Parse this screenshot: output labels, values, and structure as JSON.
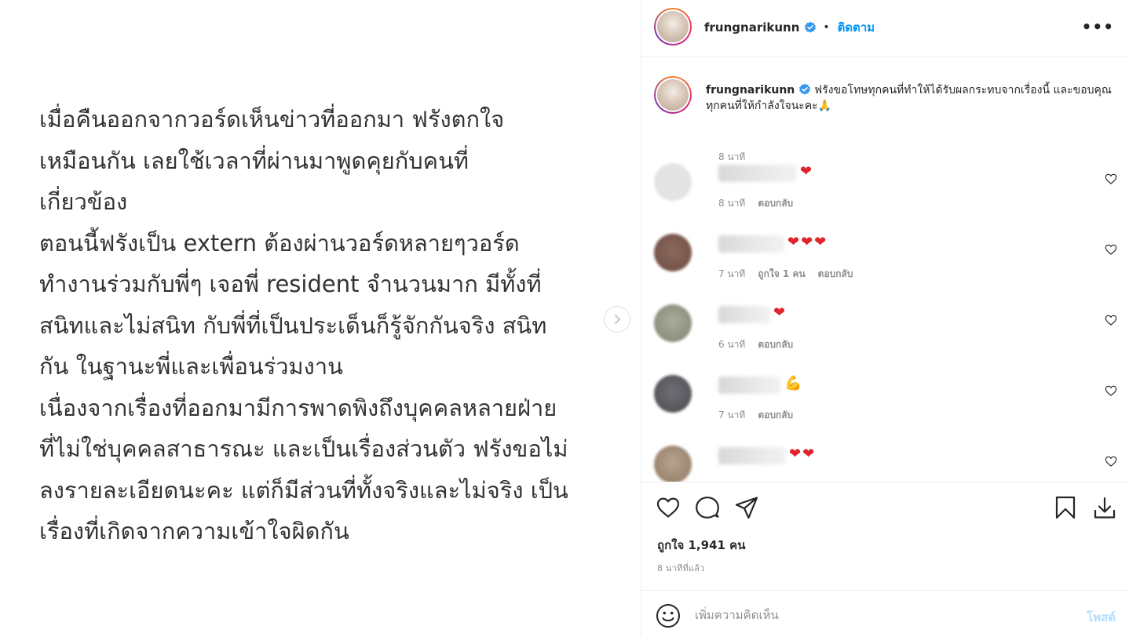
{
  "post_image": {
    "lines": [
      "เมื่อคืนออกจากวอร์ดเห็นข่าวที่ออกมา ฟรังตกใจ",
      "เหมือนกัน  เลยใช้เวลาที่ผ่านมาพูดคุยกับคนที่",
      "เกี่ยวข้อง",
      "ตอนนี้ฟรังเป็น extern ต้องผ่านวอร์ดหลายๆวอร์ด",
      "ทำงานร่วมกับพี่ๆ เจอพี่ resident จำนวนมาก มีทั้งที่",
      "สนิทและไม่สนิท กับพี่ที่เป็นประเด็นก็รู้จักกันจริง สนิท",
      "กัน  ในฐานะพี่และเพื่อนร่วมงาน",
      "เนื่องจากเรื่องที่ออกมามีการพาดพิงถึงบุคคลหลายฝ่าย",
      "ที่ไม่ใช่บุคคลสาธารณะ และเป็นเรื่องส่วนตัว ฟรังขอไม่",
      "ลงรายละเอียดนะคะ แต่ก็มีส่วนที่ทั้งจริงและไม่จริง เป็น",
      "เรื่องที่เกิดจากความเข้าใจผิดกัน"
    ],
    "next_icon": "chevron-right-icon"
  },
  "header": {
    "username": "frungnarikunn",
    "separator": "•",
    "follow_label": "ติดตาม",
    "more_label": "•••"
  },
  "caption": {
    "username": "frungnarikunn",
    "text": "ฟรังขอโทษทุกคนที่ทำให้ได้รับผลกระทบจากเรื่องนี้ และขอบคุณทุกคนที่ให้กำลังใจนะคะ🙏",
    "time": "8 นาที"
  },
  "comments": [
    {
      "emoji": "❤",
      "time": "8 นาที",
      "likes": "",
      "reply": "ตอบกลับ"
    },
    {
      "emoji": "❤❤❤",
      "time": "7 นาที",
      "likes": "ถูกใจ 1 คน",
      "reply": "ตอบกลับ"
    },
    {
      "emoji": "❤",
      "time": "6 นาที",
      "likes": "",
      "reply": "ตอบกลับ"
    },
    {
      "emoji": "💪",
      "time": "7 นาที",
      "likes": "",
      "reply": "ตอบกลับ"
    },
    {
      "emoji": "❤❤",
      "time": "",
      "likes": "",
      "reply": ""
    }
  ],
  "actions": {
    "likes_text": "ถูกใจ 1,941 คน",
    "posted_text": "8 นาทีที่แล้ว"
  },
  "add_comment": {
    "placeholder": "เพิ่มความคิดเห็น",
    "post_label": "โพสต์"
  },
  "colors": {
    "link_blue": "#0095f6",
    "post_disabled": "#b2dffc",
    "muted": "#8e8e8e",
    "heart_red": "#e0242b"
  }
}
